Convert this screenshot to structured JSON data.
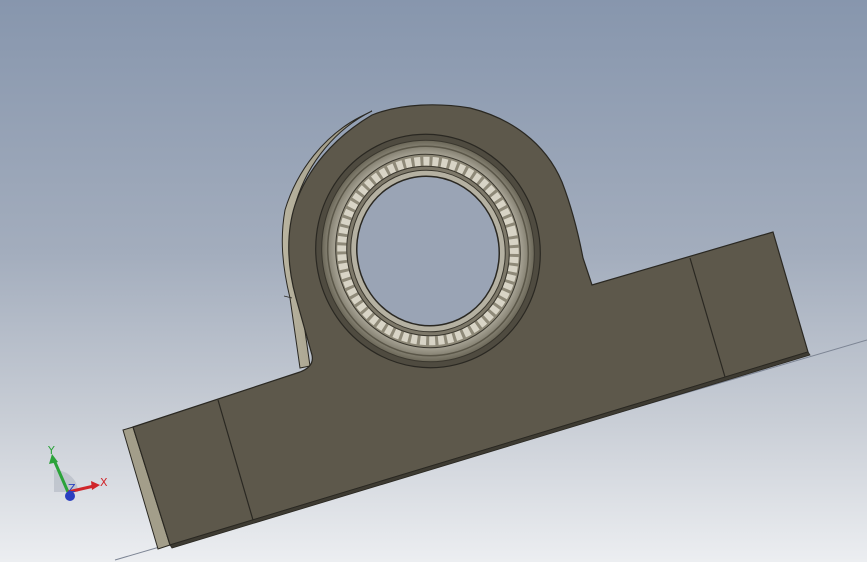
{
  "viewport": {
    "background_top": "#8796ad",
    "background_bottom": "#eceef1"
  },
  "model": {
    "part_color": "#5d584b",
    "edge_color": "#2a2822",
    "side_face_color": "#a39e8a",
    "bearing_ring_color": "#9c9786"
  },
  "triad": {
    "x_label": "X",
    "y_label": "Y",
    "z_label": "Z",
    "x_color": "#d0262b",
    "y_color": "#2ba33a",
    "z_color": "#2a3fc0"
  }
}
